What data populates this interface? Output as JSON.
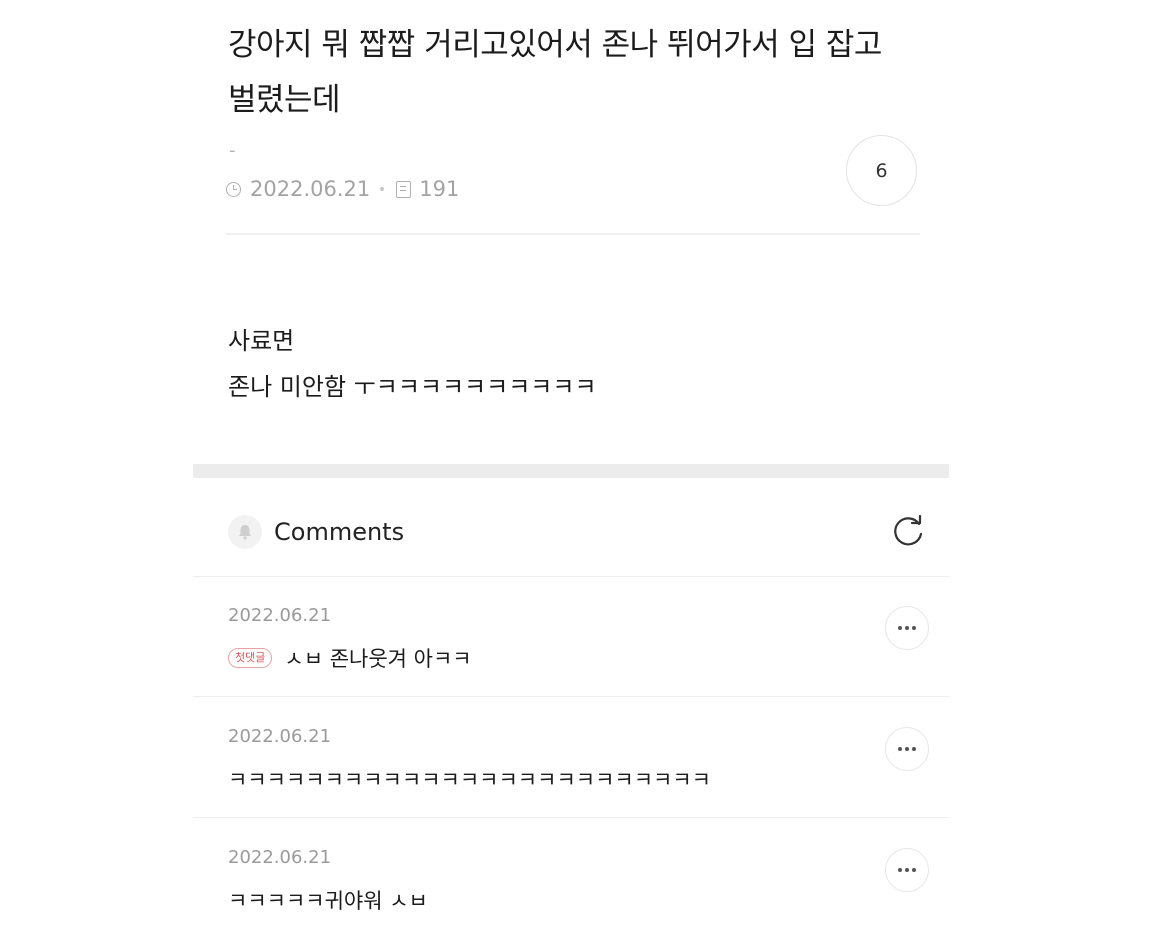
{
  "post": {
    "title": "강아지 뭐 짭짭 거리고있어서 존나 뛰어가서 입 잡고 벌렸는데",
    "author": "-",
    "date": "2022.06.21",
    "views": "191",
    "comment_count": "6",
    "body_lines": [
      "사료면",
      "존나 미안함 ㅜㅋㅋㅋㅋㅋㅋㅋㅋㅋㅋ"
    ]
  },
  "comments_section": {
    "title": "Comments",
    "icons": {
      "header": "bell-icon",
      "refresh": "refresh-icon",
      "more": "more-icon"
    }
  },
  "comments": [
    {
      "date": "2022.06.21",
      "badge": "첫댓글",
      "text": "ㅅㅂ 존나웃겨 아ㅋㅋ"
    },
    {
      "date": "2022.06.21",
      "text": "ㅋㅋㅋㅋㅋㅋㅋㅋㅋㅋㅋㅋㅋㅋㅋㅋㅋㅋㅋㅋㅋㅋㅋㅋㅋ"
    },
    {
      "date": "2022.06.21",
      "text": "ㅋㅋㅋㅋㅋ귀야워 ㅅㅂ"
    }
  ]
}
